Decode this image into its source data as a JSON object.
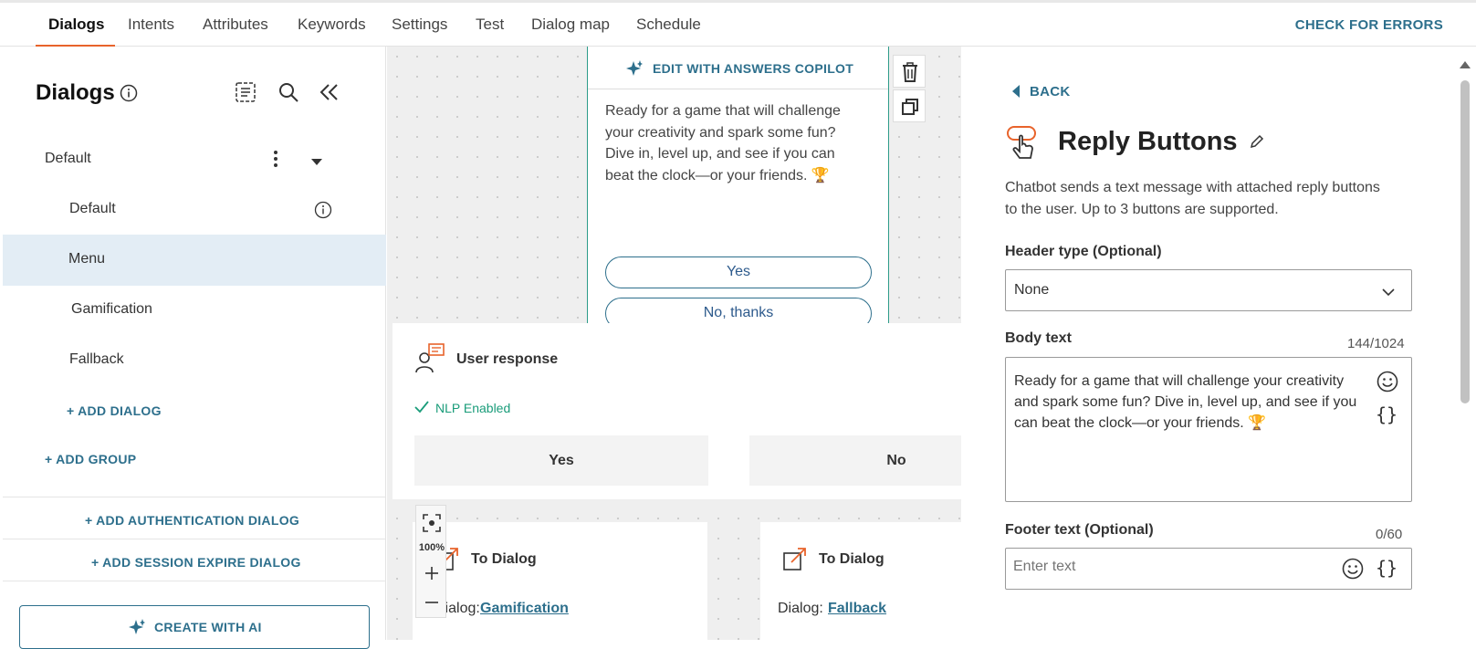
{
  "nav": {
    "tabs": [
      "Dialogs",
      "Intents",
      "Attributes",
      "Keywords",
      "Settings",
      "Test",
      "Dialog map",
      "Schedule"
    ],
    "active_tab": "Dialogs",
    "check_errors": "CHECK FOR ERRORS"
  },
  "sidebar": {
    "title": "Dialogs",
    "group": "Default",
    "items": [
      {
        "label": "Default"
      },
      {
        "label": "Menu"
      },
      {
        "label": "Gamification"
      },
      {
        "label": "Fallback"
      }
    ],
    "selected_item": "Menu",
    "add_dialog": "+ ADD DIALOG",
    "add_group": "+ ADD GROUP",
    "add_auth_dialog": "+ ADD AUTHENTICATION DIALOG",
    "add_session_dialog": "+ ADD SESSION EXPIRE DIALOG",
    "create_ai": "CREATE WITH AI"
  },
  "canvas": {
    "copilot_label": "EDIT WITH ANSWERS COPILOT",
    "message_text": "Ready for a game that will challenge your creativity and spark some fun? Dive in, level up, and see if you can beat the clock—or your friends. 🏆",
    "buttons": [
      "Yes",
      "No, thanks"
    ],
    "user_response": {
      "title": "User response",
      "nlp": "NLP Enabled",
      "options": [
        "Yes",
        "No"
      ]
    },
    "to_dialog_cards": [
      {
        "title": "To Dialog",
        "prefix": "Dialog:",
        "target": "Gamification"
      },
      {
        "title": "To Dialog",
        "prefix": "Dialog:",
        "target": "Fallback"
      }
    ],
    "zoom": "100%"
  },
  "panel": {
    "back": "BACK",
    "title": "Reply Buttons",
    "description": "Chatbot sends a text message with attached reply buttons to the user. Up to 3 buttons are supported.",
    "header_type": {
      "label": "Header type (Optional)",
      "value": "None"
    },
    "body_text": {
      "label": "Body text",
      "counter": "144/1024",
      "value": "Ready for a game that will challenge your creativity and spark some fun? Dive in, level up, and see if you can beat the clock—or your friends. 🏆"
    },
    "footer_text": {
      "label": "Footer text (Optional)",
      "counter": "0/60",
      "placeholder": "Enter text"
    }
  },
  "colors": {
    "accent_orange": "#e8632b",
    "link_teal": "#2d6f8c",
    "selected_bg": "#e3edf5",
    "nlp_green": "#1a9c7a"
  }
}
